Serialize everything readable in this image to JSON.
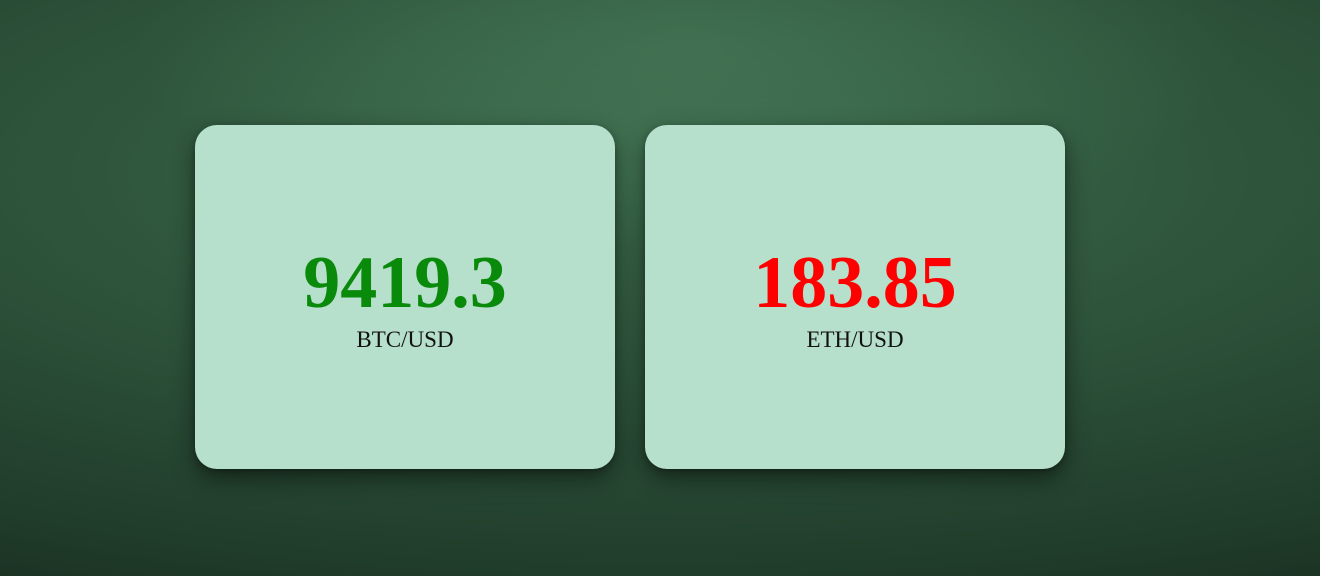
{
  "tickers": [
    {
      "price": "9419.3",
      "pair": "BTC/USD",
      "price_color": "#0a8a0a",
      "trend": "up"
    },
    {
      "price": "183.85",
      "pair": "ETH/USD",
      "price_color": "#ff0000",
      "trend": "down"
    }
  ],
  "colors": {
    "background": "#2c5139",
    "card": "#b6dfcc",
    "pair_text": "#111111"
  }
}
